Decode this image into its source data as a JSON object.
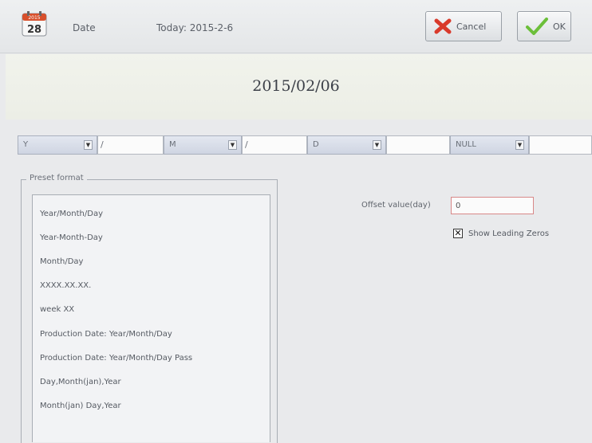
{
  "header": {
    "calendar_month": "2015",
    "calendar_day": "28",
    "title": "Date",
    "today": "Today: 2015-2-6",
    "cancel_label": "Cancel",
    "ok_label": "OK"
  },
  "date_display": "2015/02/06",
  "format_row": {
    "year_select": "Y",
    "sep1": "/",
    "month_select": "M",
    "sep2": "/",
    "day_select": "D",
    "sep3": "",
    "extra_select": "NULL",
    "sep4": ""
  },
  "preset": {
    "label": "Preset format",
    "items": [
      "Year/Month/Day",
      "Year-Month-Day",
      "Month/Day",
      "XXXX.XX.XX.",
      "week XX",
      "Production Date: Year/Month/Day",
      "Production Date: Year/Month/Day Pass",
      "Day,Month(jan),Year",
      "Month(jan) Day,Year"
    ]
  },
  "offset": {
    "label": "Offset value(day)",
    "value": "0"
  },
  "leading_zeros": {
    "label": "Show Leading Zeros",
    "checked": true
  },
  "colors": {
    "cancel_x": "#d93a2b",
    "ok_check": "#6cbf3a",
    "calendar_red": "#d8502c"
  }
}
